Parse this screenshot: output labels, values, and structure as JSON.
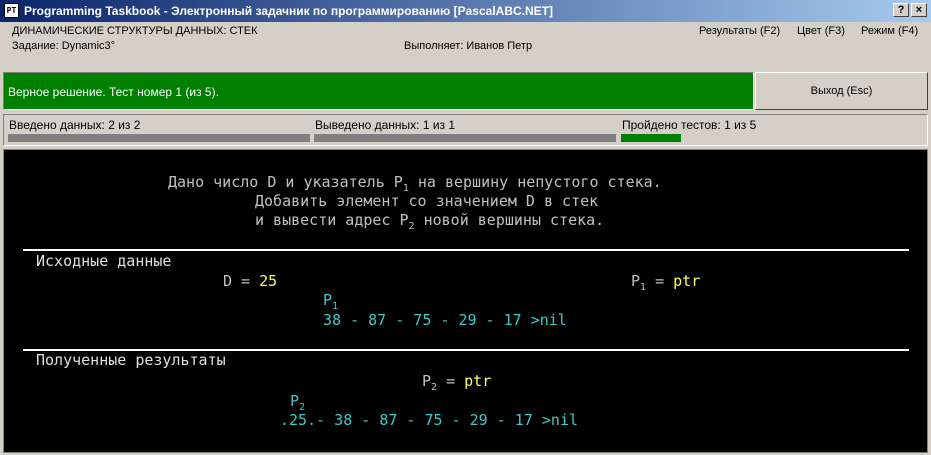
{
  "window": {
    "title": "Programming Taskbook - Электронный задачник по программированию [PascalABC.NET]",
    "icon_label": "PT",
    "help_glyph": "?",
    "close_glyph": "×"
  },
  "header": {
    "topic": "ДИНАМИЧЕСКИЕ СТРУКТУРЫ ДАННЫХ: СТЕК",
    "task": "Задание: Dynamic3°",
    "performer": "Выполняет: Иванов Петр",
    "menu": {
      "results": "Результаты (F2)",
      "color": "Цвет (F3)",
      "mode": "Режим (F4)"
    }
  },
  "status": {
    "message": "Верное решение. Тест номер 1 (из 5).",
    "color": "#008000",
    "exit_label": "Выход (Esc)"
  },
  "progress": {
    "input": {
      "label": "Введено данных:  2 из 2",
      "fraction": 1.0
    },
    "output": {
      "label": "Выведено данных:  1 из 1",
      "fraction": 1.0
    },
    "tests": {
      "label": "Пройдено тестов:  1 из 5",
      "fraction": 0.2
    }
  },
  "task_text": {
    "line1_a": "Дано число D и указатель P",
    "line1_sub": "1",
    "line1_b": " на вершину непустого стека.",
    "line2": "Добавить элемент со значением D в стек",
    "line3_a": "и вывести адрес P",
    "line3_sub": "2",
    "line3_b": " новой вершины стека."
  },
  "input_section": {
    "heading": "Исходные данные",
    "d_label": "D = ",
    "d_value": "25",
    "p1_label": "P",
    "p1_sub": "1",
    "p1_eq": " = ",
    "p1_value": "ptr",
    "pointer_label": "P",
    "pointer_sub": "1",
    "stack": "38 - 87 - 75 - 29 - 17 >nil"
  },
  "result_section": {
    "heading": "Полученные результаты",
    "p2_label": "P",
    "p2_sub": "2",
    "p2_eq": " = ",
    "p2_value": "ptr",
    "pointer_label": "P",
    "pointer_sub": "2",
    "stack": ".25.- 38 - 87 - 75 - 29 - 17 >nil"
  }
}
